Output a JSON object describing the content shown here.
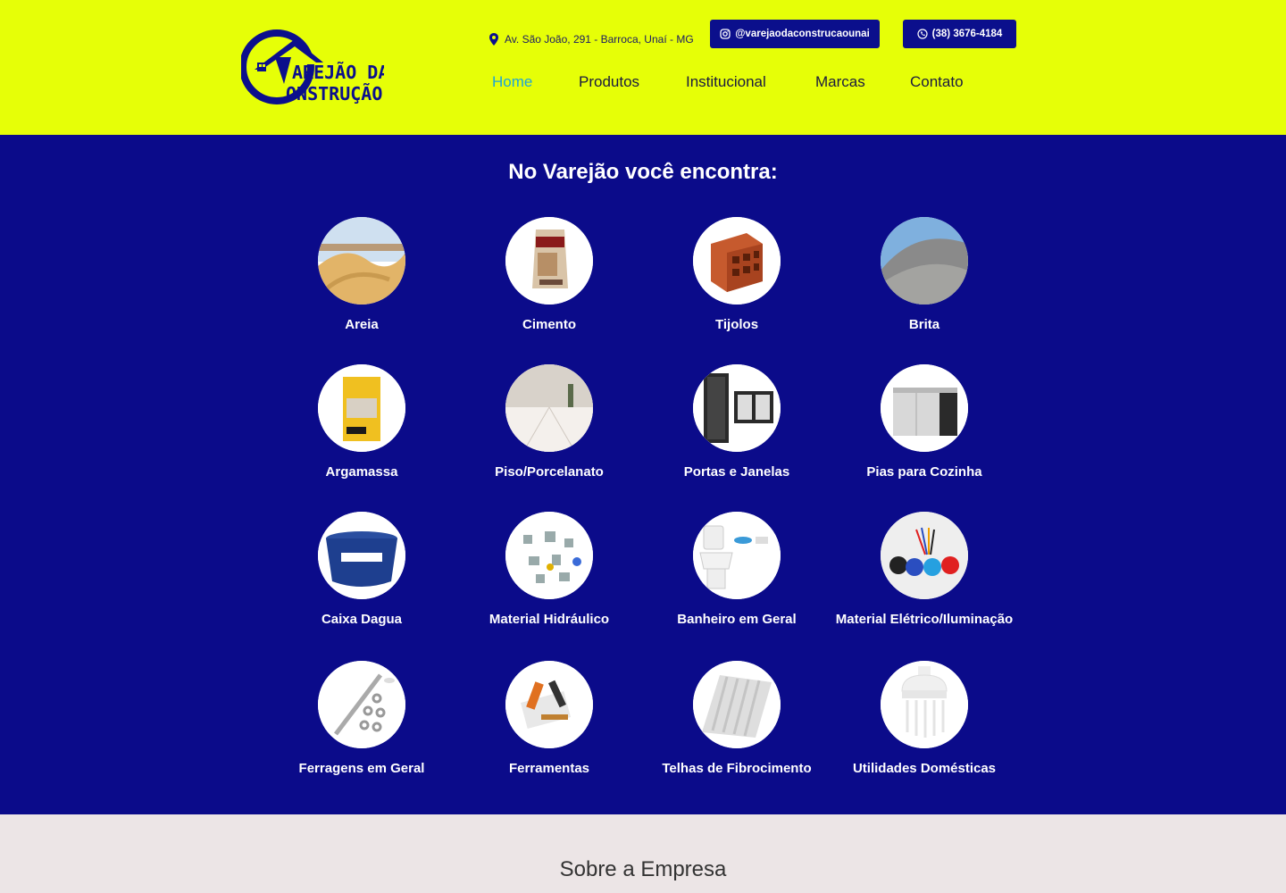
{
  "header": {
    "logo_text": "VAREJÃO DA CONSTRUÇÃO",
    "address": "Av. São João, 291 - Barroca, Unaí - MG",
    "instagram": "@varejaodaconstrucaounai",
    "phone": "(38) 3676-4184",
    "nav": [
      "Home",
      "Produtos",
      "Institucional",
      "Marcas",
      "Contato"
    ],
    "active_nav": "Home"
  },
  "colors": {
    "header_bg": "#e6ff07",
    "main_bg": "#0b0b8a",
    "button_bg": "#0b0f8c",
    "nav_active": "#1ea4d8"
  },
  "categories": {
    "title": "No Varejão você encontra:",
    "items": [
      {
        "label": "Areia",
        "icon": "sand-image"
      },
      {
        "label": "Cimento",
        "icon": "cement-bag-image"
      },
      {
        "label": "Tijolos",
        "icon": "brick-image"
      },
      {
        "label": "Brita",
        "icon": "gravel-image"
      },
      {
        "label": "Argamassa",
        "icon": "mortar-bag-image"
      },
      {
        "label": "Piso/Porcelanato",
        "icon": "tile-floor-image"
      },
      {
        "label": "Portas e Janelas",
        "icon": "door-window-image"
      },
      {
        "label": "Pias para Cozinha",
        "icon": "kitchen-sink-image"
      },
      {
        "label": "Caixa Dagua",
        "icon": "water-tank-image"
      },
      {
        "label": "Material Hidráulico",
        "icon": "plumbing-fittings-image"
      },
      {
        "label": "Banheiro em Geral",
        "icon": "toilet-image"
      },
      {
        "label": "Material Elétrico/Iluminação",
        "icon": "electric-cables-image"
      },
      {
        "label": "Ferragens em Geral",
        "icon": "hardware-bolts-image"
      },
      {
        "label": "Ferramentas",
        "icon": "tools-image"
      },
      {
        "label": "Telhas de Fibrocimento",
        "icon": "roof-tile-image"
      },
      {
        "label": "Utilidades Domésticas",
        "icon": "shower-head-image"
      }
    ]
  },
  "about": {
    "title": "Sobre a Empresa"
  }
}
